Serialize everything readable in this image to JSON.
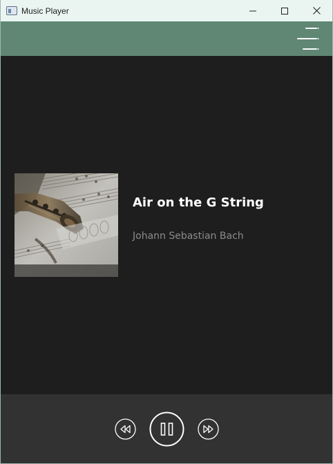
{
  "window": {
    "title": "Music Player",
    "icon": "app-window-icon",
    "controls": [
      "minimize-icon",
      "maximize-icon",
      "close-icon"
    ]
  },
  "header": {
    "menu_icon": "hamburger-menu-icon",
    "accent_color": "#5f8774"
  },
  "track": {
    "title": "Air on the G String",
    "artist": "Johann Sebastian Bach",
    "album_art": "saxophone-sheet-music-artwork"
  },
  "player": {
    "state": "playing",
    "controls": [
      "rewind-icon",
      "pause-icon",
      "fast-forward-icon"
    ]
  },
  "colors": {
    "background": "#1e1e1e",
    "player_bar": "#323232",
    "title_text": "#ffffff",
    "artist_text": "#8c8c8c"
  }
}
